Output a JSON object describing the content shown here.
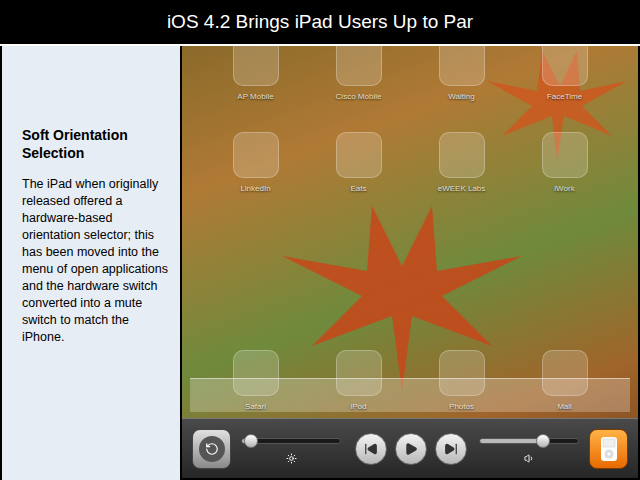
{
  "title": "iOS 4.2 Brings iPad Users Up to Par",
  "sidebar": {
    "heading": "Soft Orientation Selection",
    "body": "The iPad when originally released offered a hardware-based orientation selector; this has been moved into the menu of open applications and the hardware switch converted into a mute switch to match the iPhone."
  },
  "home_screen": {
    "rows": [
      [
        {
          "label": "AP Mobile"
        },
        {
          "label": "Cisco Mobile"
        },
        {
          "label": "Waiting"
        },
        {
          "label": "FaceTime"
        }
      ],
      [
        {
          "label": "LinkedIn"
        },
        {
          "label": "Eats"
        },
        {
          "label": "eWEEK Labs"
        },
        {
          "label": "iWork"
        }
      ]
    ],
    "dock": [
      {
        "label": "Safari"
      },
      {
        "label": "iPod"
      },
      {
        "label": "Photos"
      },
      {
        "label": "Mail"
      }
    ]
  },
  "tray": {
    "orientation_lock": {
      "locked": false
    },
    "brightness": {
      "level": 0.04
    },
    "playback": {
      "playing": false
    },
    "volume": {
      "level": 0.66
    }
  }
}
